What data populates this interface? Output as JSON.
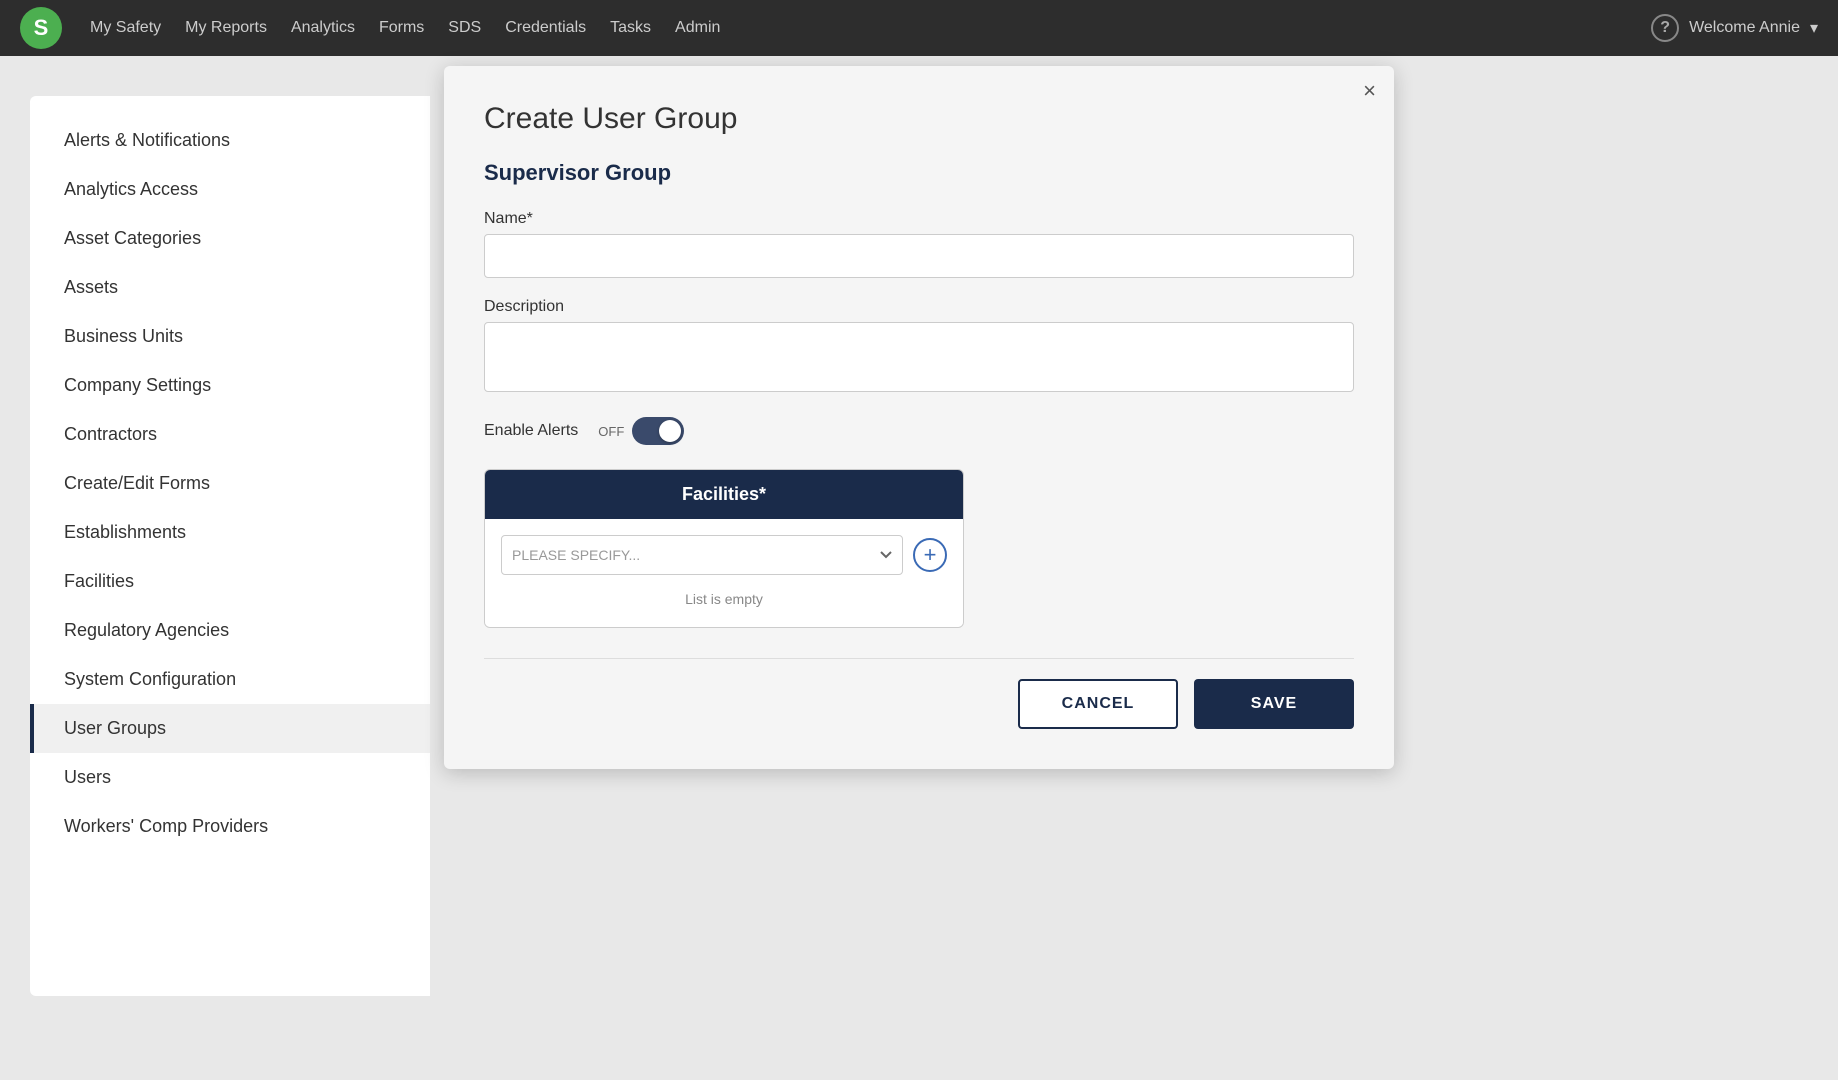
{
  "nav": {
    "logo_letter": "S",
    "links": [
      {
        "label": "My Safety",
        "name": "my-safety"
      },
      {
        "label": "My Reports",
        "name": "my-reports"
      },
      {
        "label": "Analytics",
        "name": "analytics"
      },
      {
        "label": "Forms",
        "name": "forms"
      },
      {
        "label": "SDS",
        "name": "sds"
      },
      {
        "label": "Credentials",
        "name": "credentials"
      },
      {
        "label": "Tasks",
        "name": "tasks"
      },
      {
        "label": "Admin",
        "name": "admin"
      }
    ],
    "welcome_text": "Welcome Annie",
    "help_icon": "?"
  },
  "sidebar": {
    "items": [
      {
        "label": "Alerts & Notifications",
        "active": false
      },
      {
        "label": "Analytics Access",
        "active": false
      },
      {
        "label": "Asset Categories",
        "active": false
      },
      {
        "label": "Assets",
        "active": false
      },
      {
        "label": "Business Units",
        "active": false
      },
      {
        "label": "Company Settings",
        "active": false
      },
      {
        "label": "Contractors",
        "active": false
      },
      {
        "label": "Create/Edit Forms",
        "active": false
      },
      {
        "label": "Establishments",
        "active": false
      },
      {
        "label": "Facilities",
        "active": false
      },
      {
        "label": "Regulatory Agencies",
        "active": false
      },
      {
        "label": "System Configuration",
        "active": false
      },
      {
        "label": "User Groups",
        "active": true
      },
      {
        "label": "Users",
        "active": false
      },
      {
        "label": "Workers' Comp Providers",
        "active": false
      }
    ]
  },
  "modal": {
    "title": "Create User Group",
    "subtitle": "Supervisor Group",
    "close_icon": "×",
    "name_label": "Name*",
    "name_placeholder": "",
    "description_label": "Description",
    "description_placeholder": "",
    "enable_alerts_label": "Enable Alerts",
    "toggle_off_label": "OFF",
    "facilities_header": "Facilities*",
    "facilities_placeholder": "PLEASE SPECIFY...",
    "facilities_empty_text": "List is empty",
    "add_icon": "+",
    "cancel_label": "CANCEL",
    "save_label": "SAVE"
  }
}
